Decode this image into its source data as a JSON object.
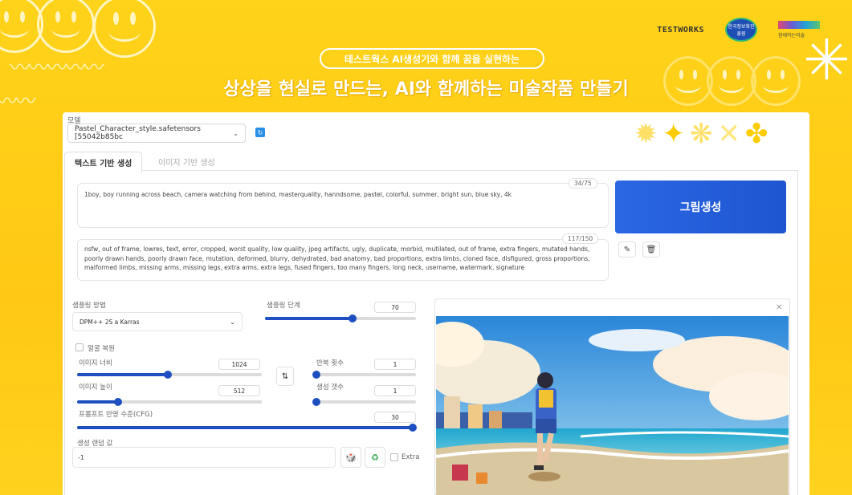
{
  "header": {
    "logos": {
      "testworks": "TESTWORKS",
      "center_logo_text": "한국정보화진흥원",
      "right_logo_text": "함께하는미술"
    },
    "subtitle": "테스트웍스 AI생성기와 함께 꿈을 실현하는",
    "title": "상상을 현실로 만드는, AI와 함께하는 미술작품 만들기"
  },
  "model": {
    "label": "모델",
    "selected": "Pastel_Character_style.safetensors [55042b85bc",
    "dropdown_icon": "chevron-down-icon",
    "refresh_icon": "refresh-icon"
  },
  "tabs": [
    {
      "label": "텍스트 기반 생성",
      "active": true
    },
    {
      "label": "이미지 기반 생성",
      "active": false
    }
  ],
  "prompt": {
    "value": "1boy, boy running across beach, camera watching from behind, masterquality, hanndsome, pastel, colorful, summer, bright sun, blue sky, 4k",
    "counter": "34/75"
  },
  "negative_prompt": {
    "value": "nsfw, out of frame, lowres, text, error, cropped, worst quality, low quality, jpeg artifacts, ugly, duplicate, morbid, mutilated, out of frame, extra fingers, mutated hands, poorly drawn hands, poorly drawn face, mutation, deformed, blurry, dehydrated, bad anatomy, bad proportions, extra limbs, cloned face, disfigured, gross proportions, malformed limbs, missing arms, missing legs, extra arms, extra legs, fused fingers, too many fingers, long neck, username, watermark, signature",
    "counter": "117/150"
  },
  "generate_button": "그림생성",
  "tool_buttons": {
    "edit_icon": "pencil-icon",
    "delete_icon": "trash-icon"
  },
  "settings": {
    "sampling_method": {
      "label": "샘플링 방법",
      "value": "DPM++ 2S a Karras"
    },
    "sampling_steps": {
      "label": "샘플링 단계",
      "value": "70",
      "fraction": 0.58
    },
    "face_restore": {
      "label": "얼굴 복원",
      "checked": false
    },
    "width": {
      "label": "이미지 너비",
      "value": "1024",
      "fraction": 0.49
    },
    "height": {
      "label": "이미지 높이",
      "value": "512",
      "fraction": 0.22
    },
    "batch_count": {
      "label": "반복 횟수",
      "value": "1",
      "fraction": 0.0
    },
    "batch_size": {
      "label": "생성 갯수",
      "value": "1",
      "fraction": 0.0
    },
    "cfg": {
      "label": "프롬프트 반영 수준(CFG)",
      "value": "30",
      "fraction": 1.0
    },
    "seed": {
      "label": "생성 랜덤 값",
      "value": "-1",
      "extra_label": "Extra"
    }
  },
  "image_output": {
    "close_icon": "close-icon"
  },
  "colors": {
    "background": "#ffd21f",
    "accent_blue": "#1e55d0",
    "slider_blue": "#1e4fc0"
  }
}
